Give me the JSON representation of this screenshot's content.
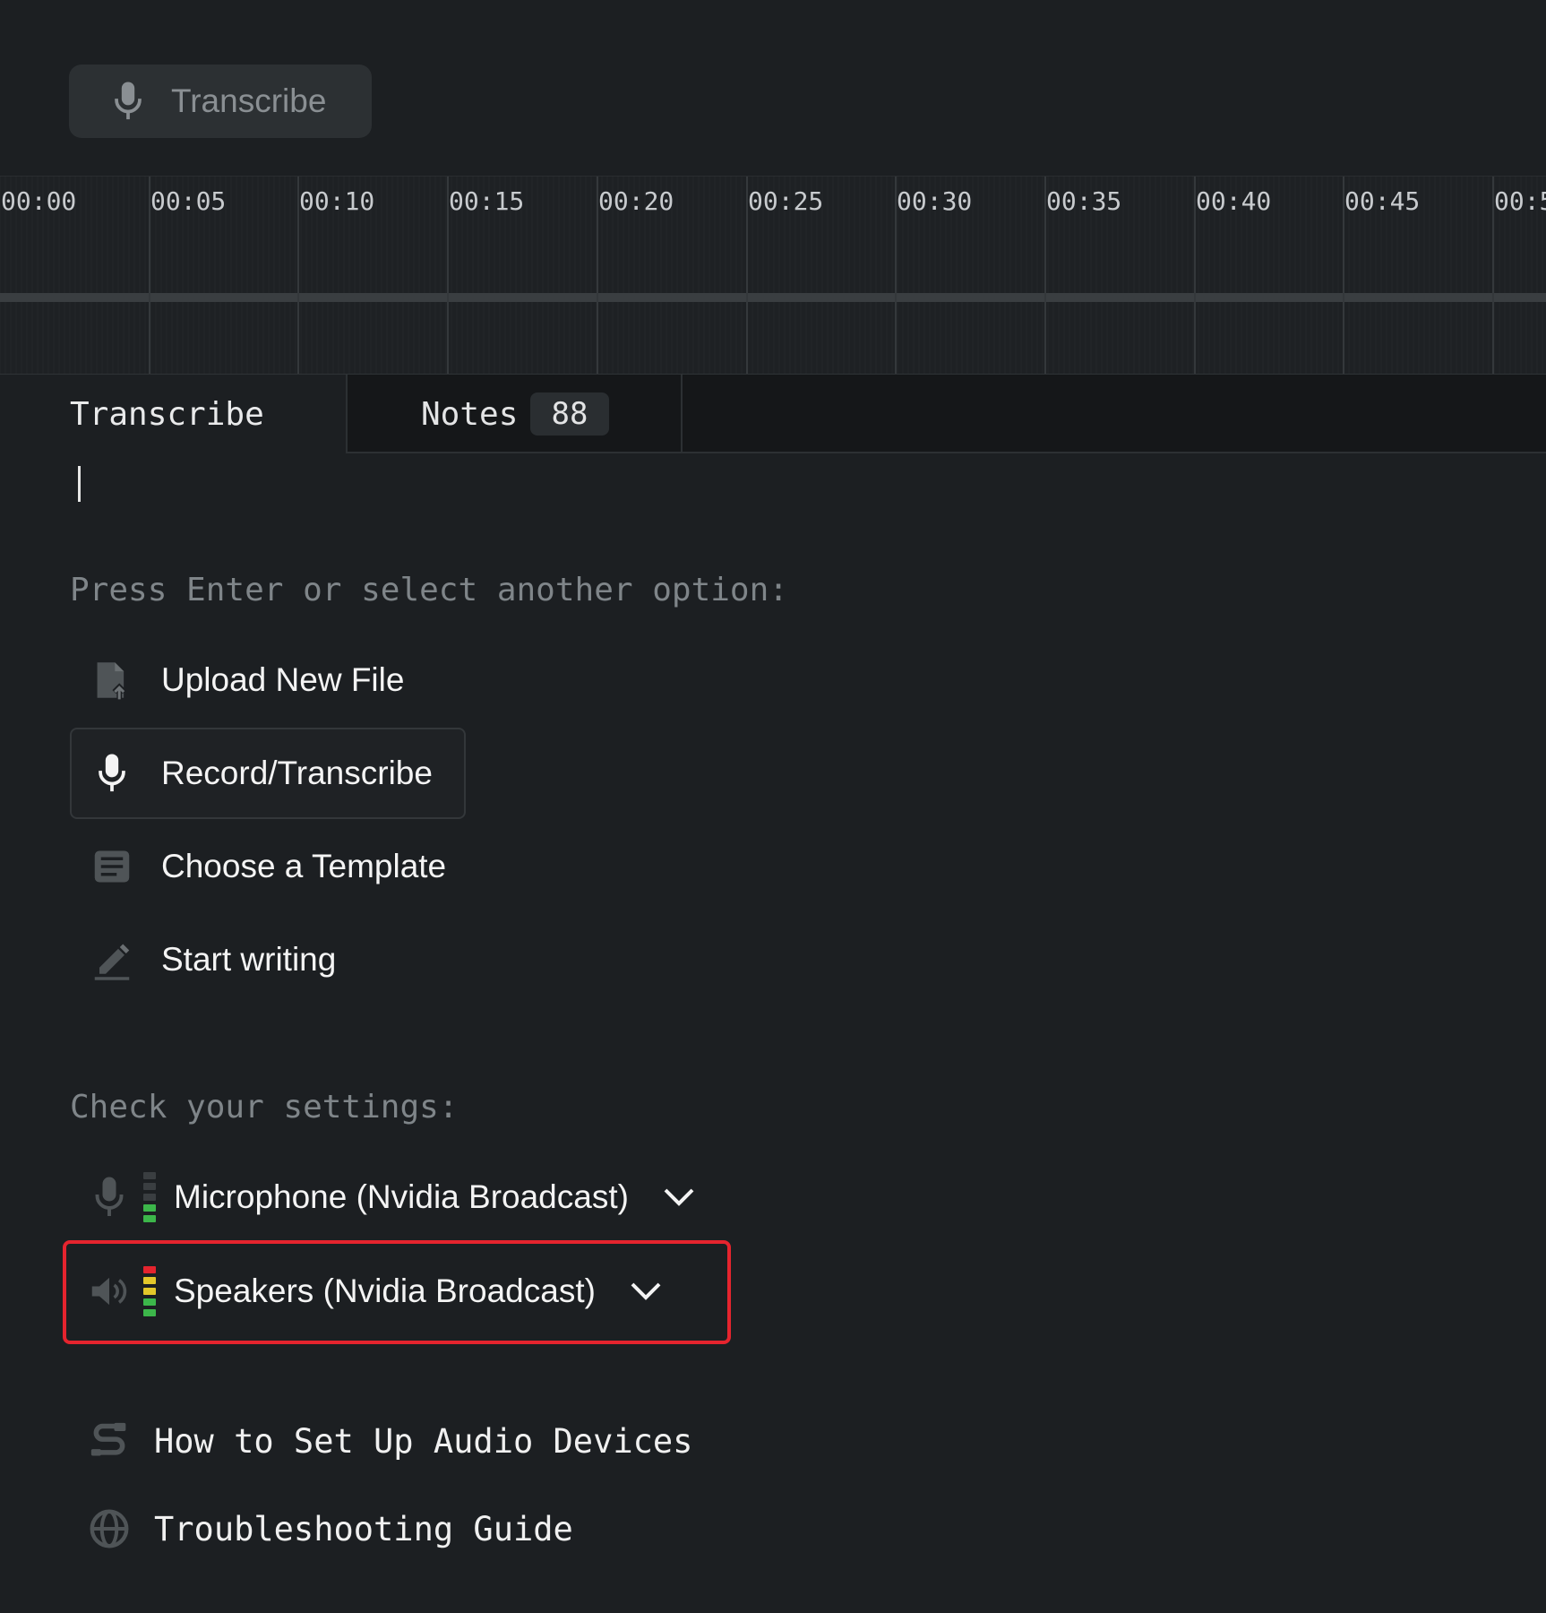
{
  "toolbar": {
    "transcribe_button": "Transcribe",
    "mic_icon": "microphone-icon"
  },
  "timeline": {
    "ticks": [
      "00:00",
      "00:05",
      "00:10",
      "00:15",
      "00:20",
      "00:25",
      "00:30",
      "00:35",
      "00:40",
      "00:45",
      "00:5"
    ]
  },
  "tabs": {
    "transcribe": "Transcribe",
    "notes": "Notes",
    "notes_count": "88"
  },
  "prompt": {
    "label": "Press Enter or select another option:",
    "options": [
      {
        "label": "Upload New File",
        "icon": "file-upload-icon"
      },
      {
        "label": "Record/Transcribe",
        "icon": "microphone-icon",
        "selected": true
      },
      {
        "label": "Choose a Template",
        "icon": "template-icon"
      },
      {
        "label": "Start writing",
        "icon": "pen-icon"
      }
    ]
  },
  "settings": {
    "label": "Check your settings:",
    "microphone": "Microphone (Nvidia Broadcast)",
    "speakers": "Speakers (Nvidia Broadcast)",
    "mic_level": 0.4,
    "speaker_level": 1.0
  },
  "help": {
    "setup": "How to Set Up Audio Devices",
    "troubleshooting": "Troubleshooting Guide"
  },
  "colors": {
    "background": "#1c1f22",
    "highlight": "#e5242e",
    "meter_green": "#3cb64a",
    "meter_yellow": "#e3c72a",
    "meter_red": "#e5242e"
  }
}
